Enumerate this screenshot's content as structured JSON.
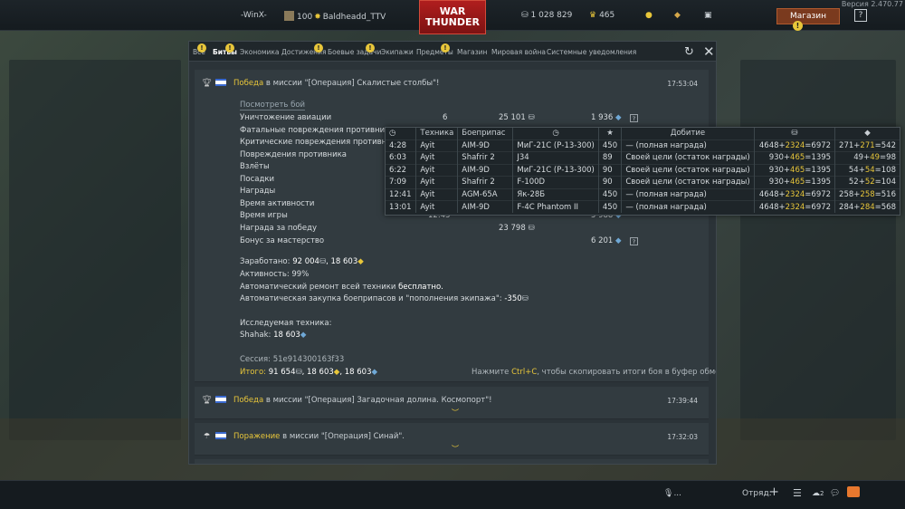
{
  "version": "Версия 2.470.77",
  "topbar": {
    "clan": "-WinX-",
    "level": "100",
    "nick": "Baldheadd_TTV",
    "logo_top": "WAR",
    "logo_bottom": "THUNDER",
    "silver": "1 028 829",
    "gold": "465",
    "shop": "Магазин",
    "badge": "!",
    "help": "?"
  },
  "tabs": [
    {
      "label": "Все",
      "badge": "!"
    },
    {
      "label": "Битвы",
      "badge": "!"
    },
    {
      "label": "Экономика"
    },
    {
      "label": "Достижения",
      "badge": "!"
    },
    {
      "label": "Боевые задачи",
      "badge": "!"
    },
    {
      "label": "Экипажи"
    },
    {
      "label": "Предметы",
      "badge": "!"
    },
    {
      "label": "Магазин"
    },
    {
      "label": "Мировая война"
    },
    {
      "label": "Системные уведомления"
    }
  ],
  "messages": [
    {
      "result": "Победа",
      "text": " в миссии \"[Операция] Скалистые столбы\"!",
      "time": "17:53:04"
    },
    {
      "result": "Победа",
      "text": " в миссии \"[Операция] Загадочная долина. Космопорт\"!",
      "time": "17:39:44"
    },
    {
      "result": "Поражение",
      "text": " в миссии \"[Операция] Синай\".",
      "time": "17:32:03"
    }
  ],
  "report": {
    "view_battle": "Посмотреть бой",
    "rows": [
      {
        "label": "Уничтожение авиации",
        "count": "6",
        "silver": "25 101",
        "rp": "1 936"
      },
      {
        "label": "Фатальные повреждения противника"
      },
      {
        "label": "Критические повреждения противника"
      },
      {
        "label": "Повреждения противника"
      },
      {
        "label": "Взлёты"
      },
      {
        "label": "Посадки"
      },
      {
        "label": "Награды"
      },
      {
        "label": "Время активности"
      },
      {
        "label": "Время игры",
        "count": "12:45",
        "rp": "5 988"
      },
      {
        "label": "Награда за победу",
        "silver": "23 798"
      },
      {
        "label": "Бонус за мастерство",
        "rp": "6 201"
      }
    ],
    "earned_label": "Заработано: ",
    "earned_value": "92 004",
    "earned_rp": ", 18 603",
    "activity": "Активность: 99%",
    "repair_prefix": "Автоматический ремонт всей техники ",
    "repair_value": "бесплатно.",
    "restock_prefix": "Автоматическая закупка боеприпасов и \"пополнения экипажа\": ",
    "restock_value": "-350",
    "research_label": "Исследуемая техника:",
    "research_vehicle": "Shahak: ",
    "research_rp": "18 603",
    "session": "Сессия: 51e914300163f33",
    "total_label": "Итого: ",
    "total_value": "91 654",
    "total_rp": ", 18 603",
    "total_rp2": ", 18 603",
    "copy_hint_prefix": "Нажмите ",
    "copy_hint_key": "Ctrl+C",
    "copy_hint_suffix": ", чтобы скопировать итоги боя в буфер обмена"
  },
  "tooltip": {
    "headers": [
      "Техника",
      "Боеприпас",
      "Добитие"
    ],
    "rows": [
      [
        "4:28",
        "Ayit",
        "AIM-9D",
        "МиГ-21С (Р-13-300)",
        "450",
        "— (полная награда)",
        "4648",
        "2324",
        "6972",
        "271",
        "271",
        "542"
      ],
      [
        "6:03",
        "Ayit",
        "Shafrir 2",
        "J34",
        "89",
        "Своей цели (остаток награды)",
        "930",
        "465",
        "1395",
        "49",
        "49",
        "98"
      ],
      [
        "6:22",
        "Ayit",
        "AIM-9D",
        "МиГ-21С (Р-13-300)",
        "90",
        "Своей цели (остаток награды)",
        "930",
        "465",
        "1395",
        "54",
        "54",
        "108"
      ],
      [
        "7:09",
        "Ayit",
        "Shafrir 2",
        "F-100D",
        "90",
        "Своей цели (остаток награды)",
        "930",
        "465",
        "1395",
        "52",
        "52",
        "104"
      ],
      [
        "12:41",
        "Ayit",
        "AGM-65A",
        "Як-28Б",
        "450",
        "— (полная награда)",
        "4648",
        "2324",
        "6972",
        "258",
        "258",
        "516"
      ],
      [
        "13:01",
        "Ayit",
        "AIM-9D",
        "F-4C Phantom II",
        "450",
        "— (полная награда)",
        "4648",
        "2324",
        "6972",
        "284",
        "284",
        "568"
      ]
    ]
  },
  "bottombar": {
    "mic": "...",
    "squad": "Отряд:",
    "friends_count": "2"
  }
}
